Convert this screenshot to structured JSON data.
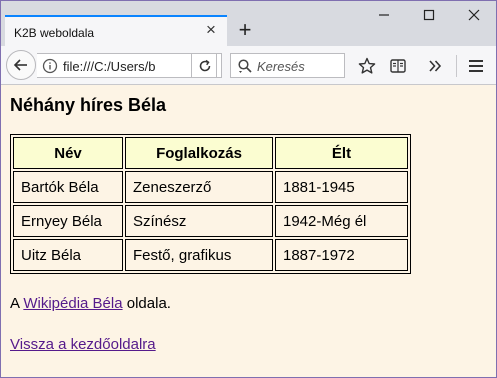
{
  "browser": {
    "tab_title": "K2B weboldala",
    "url": "file:///C:/Users/b",
    "search_placeholder": "Keresés"
  },
  "page": {
    "heading": "Néhány híres Béla",
    "table": {
      "headers": [
        "Név",
        "Foglalkozás",
        "Élt"
      ],
      "rows": [
        [
          "Bartók Béla",
          "Zeneszerző",
          "1881-1945"
        ],
        [
          "Ernyey Béla",
          "Színész",
          "1942-Még él"
        ],
        [
          "Uitz Béla",
          "Festő, grafikus",
          "1887-1972"
        ]
      ]
    },
    "para_prefix": "A ",
    "wiki_link": "Wikipédia Béla",
    "para_suffix": " oldala.",
    "back_link": "Vissza a kezdőoldalra"
  },
  "colors": {
    "page_bg": "#fdf4e5",
    "header_bg": "#fbfdd1",
    "link": "#551a8b"
  }
}
